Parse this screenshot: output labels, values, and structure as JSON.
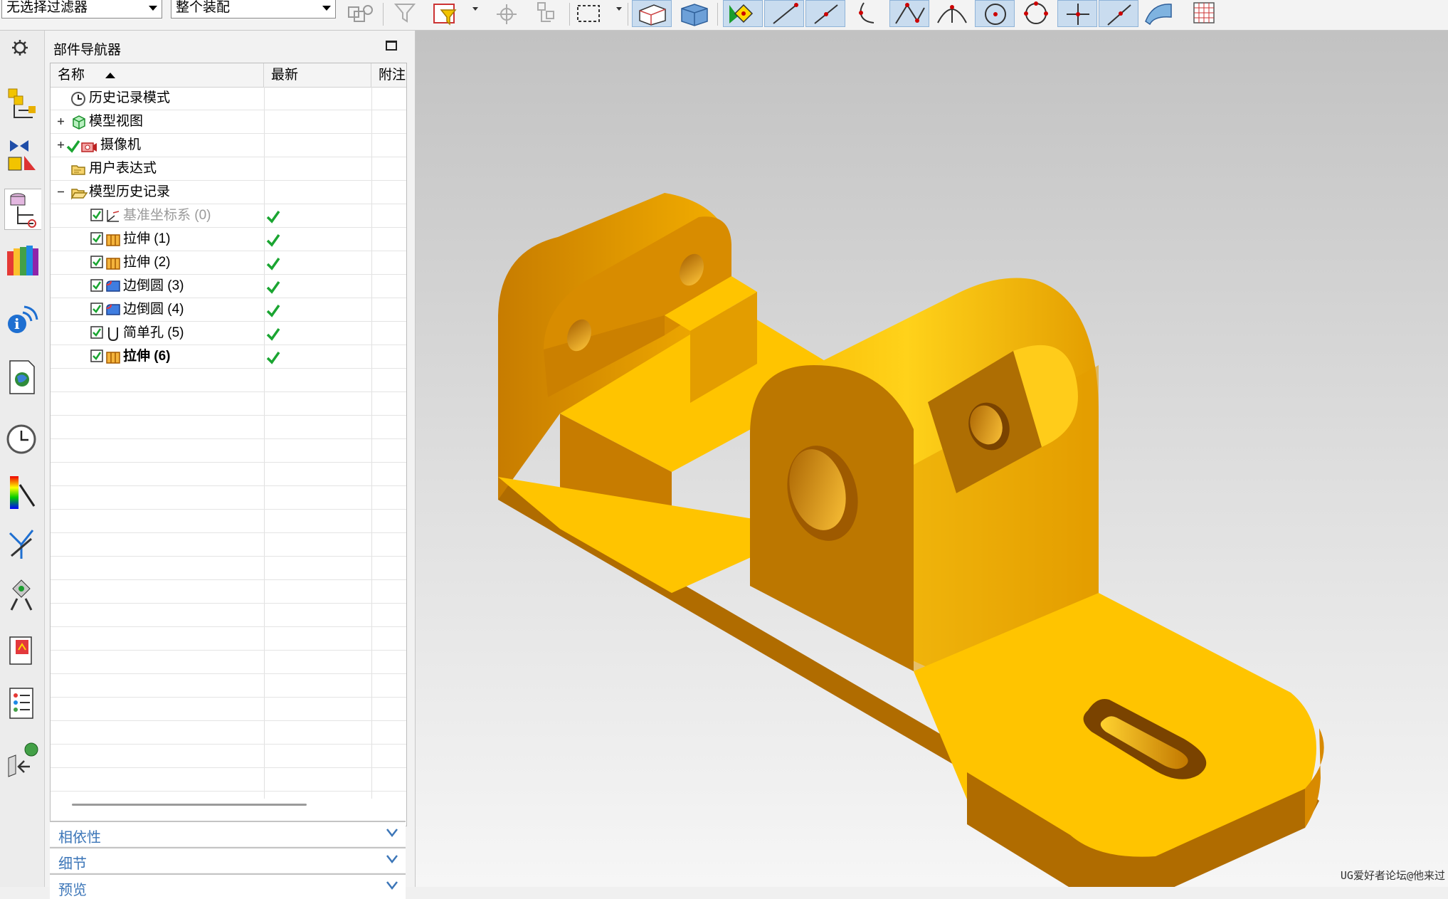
{
  "toolbar": {
    "selection_filter": "无选择过滤器",
    "selection_scope": "整个装配"
  },
  "navigator": {
    "title": "部件导航器",
    "columns": [
      "名称",
      "最新",
      "附注"
    ],
    "nodes": [
      {
        "label": "历史记录模式",
        "icon": "history-mode-icon"
      },
      {
        "label": "模型视图",
        "icon": "model-views-icon",
        "expandable": true
      },
      {
        "label": "摄像机",
        "icon": "cameras-icon",
        "expandable": true
      },
      {
        "label": "用户表达式",
        "icon": "folder-icon"
      },
      {
        "label": "模型历史记录",
        "icon": "folder-open-icon",
        "expanded": true
      },
      {
        "label": "基准坐标系 (0)",
        "icon": "datum-csys-icon",
        "up_to_date": true,
        "dimmed": true
      },
      {
        "label": "拉伸 (1)",
        "icon": "extrude-icon",
        "up_to_date": true
      },
      {
        "label": "拉伸 (2)",
        "icon": "extrude-icon",
        "up_to_date": true
      },
      {
        "label": "边倒圆 (3)",
        "icon": "edge-blend-icon",
        "up_to_date": true
      },
      {
        "label": "边倒圆 (4)",
        "icon": "edge-blend-icon",
        "up_to_date": true
      },
      {
        "label": "简单孔 (5)",
        "icon": "hole-icon",
        "up_to_date": true
      },
      {
        "label": "拉伸 (6)",
        "icon": "extrude-icon",
        "up_to_date": true,
        "current": true
      }
    ],
    "panels": [
      "相依性",
      "细节",
      "预览"
    ]
  },
  "colors": {
    "model_top": "#ffc400",
    "model_front": "#c77c00",
    "model_side": "#e29b00",
    "check_green": "#1aa531",
    "panel_link": "#3c76b8"
  },
  "watermark": "UG爱好者论坛@他来过"
}
